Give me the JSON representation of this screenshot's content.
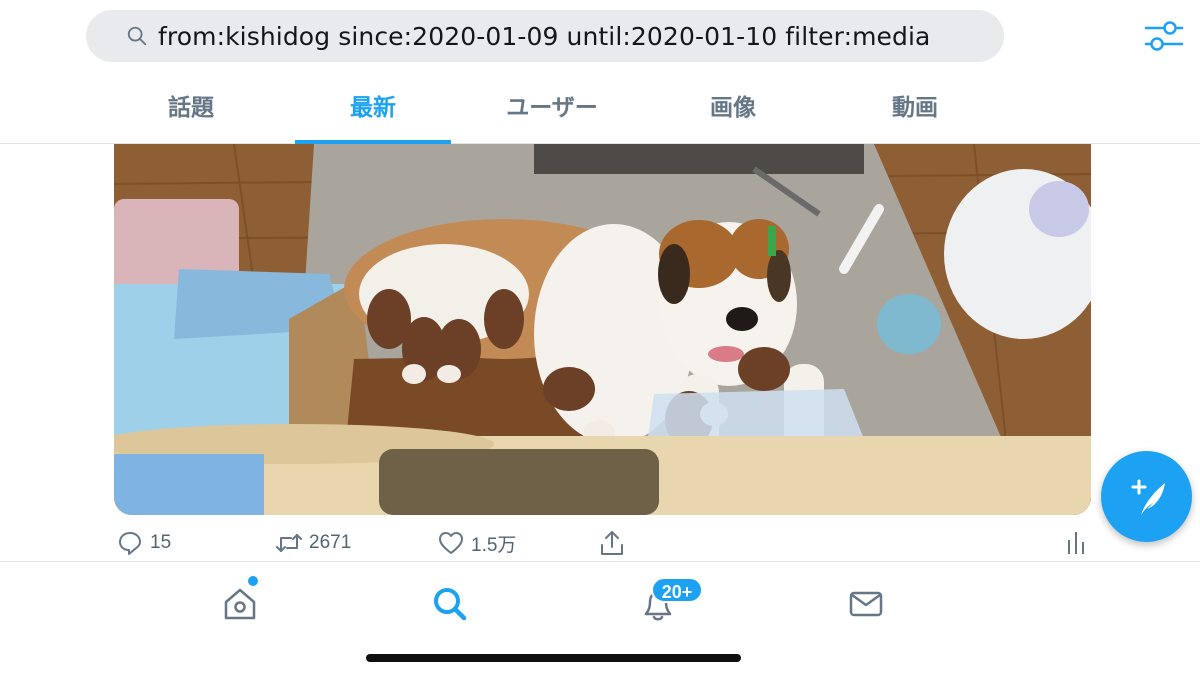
{
  "search": {
    "query": "from:kishidog since:2020-01-09 until:2020-01-10 filter:media",
    "icon": "search-icon"
  },
  "tabs": [
    {
      "label": "話題",
      "active": false
    },
    {
      "label": "最新",
      "active": true
    },
    {
      "label": "ユーザー",
      "active": false
    },
    {
      "label": "画像",
      "active": false
    },
    {
      "label": "動画",
      "active": false
    }
  ],
  "tweet": {
    "media": {
      "kind": "photo",
      "subject": "dog-with-puppies"
    },
    "actions": {
      "replies": "15",
      "retweets": "2671",
      "likes": "1.5万"
    }
  },
  "bottom_nav": {
    "notifications_badge": "20+"
  },
  "colors": {
    "accent": "#1da1f2",
    "secondary_text": "#657786",
    "search_bg": "#e8eaee"
  }
}
